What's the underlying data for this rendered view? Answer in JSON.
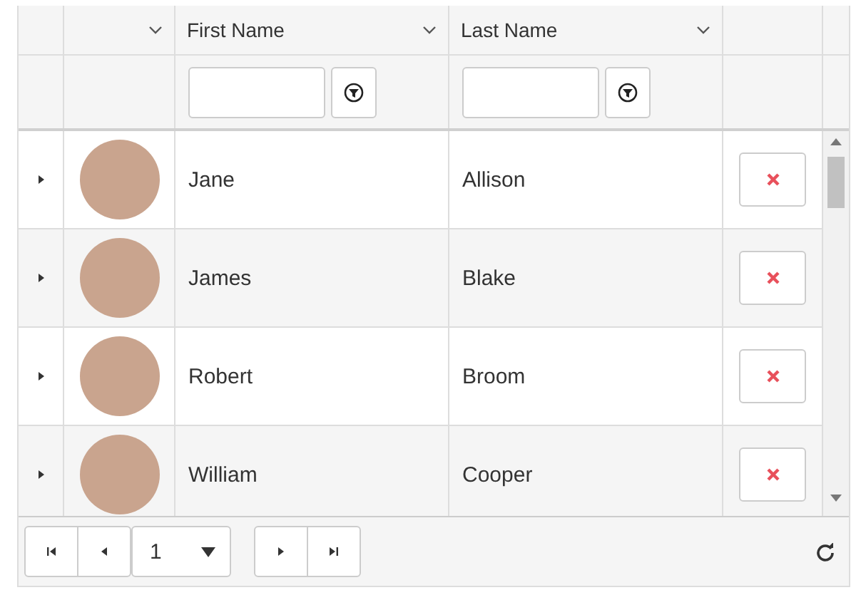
{
  "columns": [
    {
      "kind": "expand"
    },
    {
      "kind": "photo"
    },
    {
      "kind": "text",
      "label": "First Name"
    },
    {
      "kind": "text",
      "label": "Last Name"
    },
    {
      "kind": "actions"
    }
  ],
  "rows": [
    {
      "first_name": "Jane",
      "last_name": "Allison"
    },
    {
      "first_name": "James",
      "last_name": "Blake"
    },
    {
      "first_name": "Robert",
      "last_name": "Broom"
    },
    {
      "first_name": "William",
      "last_name": "Cooper"
    }
  ],
  "pager": {
    "page": "1"
  }
}
